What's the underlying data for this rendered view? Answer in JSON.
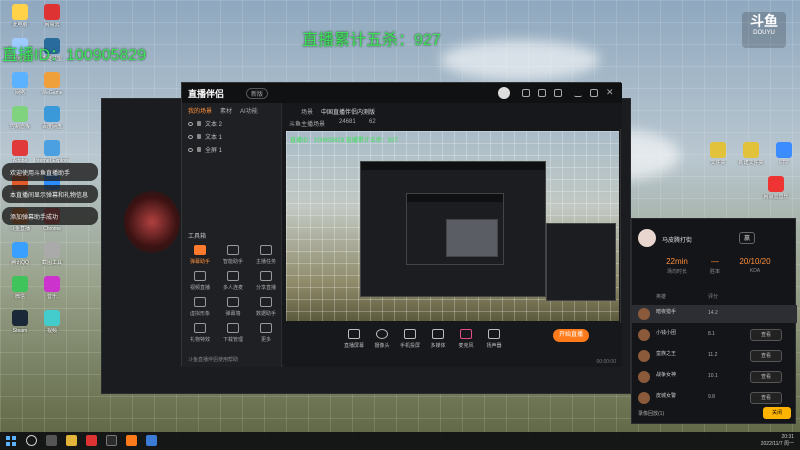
{
  "overlay": {
    "room_id": "直播ID：100905829",
    "penta_kills": "直播累计五杀：927"
  },
  "douyu_logo": {
    "main": "斗鱼",
    "sub": "DOUYU"
  },
  "chat_bubbles": [
    "欢迎使用斗鱼直播助手",
    "本直播间显示弹幕和礼物信息",
    "添加弹幕助手成功"
  ],
  "desktop_icons_left": [
    "此电脑",
    "回收站",
    "网络",
    "控制面板",
    "Adobe",
    "WPS",
    "斗鱼直播",
    "腾讯QQ",
    "微信",
    "Steam",
    "网易云",
    "英雄联盟",
    "WeGame",
    "百度网盘",
    "Internet Explorer",
    "迅雷",
    "Chrome",
    "截图工具",
    "音乐",
    "视频"
  ],
  "desktop_icons_right": [
    "文件夹",
    "新建文件夹",
    "FTP",
    "网易云音乐"
  ],
  "main_window": {
    "brand": "直播伴侣",
    "version": "新版",
    "left_tabs": [
      "我的场景",
      "素材",
      "AI功能"
    ],
    "scenes": [
      "文本 2",
      "文本 1",
      "全屏 1"
    ],
    "toolbox_title": "工具箱",
    "tools": [
      "弹幕助手",
      "智能助手",
      "主播任务",
      "视频直播",
      "多人连麦",
      "分享直播",
      "虚拟形象",
      "弹幕墙",
      "数据助手",
      "礼物特效",
      "下载管理",
      "更多"
    ],
    "footer": "斗鱼直播伴侣使用帮助",
    "stage_labels": [
      "场景",
      "中国直播伴侣内测版",
      "斗鱼主播场景",
      "24681",
      "62"
    ],
    "controls": [
      "直播屏幕",
      "摄像头",
      "手机投屏",
      "多媒体",
      "麦克风",
      "扬声器"
    ],
    "go_live": "开始直播",
    "status": "00:00:00"
  },
  "mini_overlay": "直播ID：100905829   直播累计五杀：927",
  "right_panel": {
    "name": "马皮腾打街",
    "follow": "赢",
    "stats": [
      {
        "value": "22min",
        "key": "场均时长"
      },
      {
        "value": "—",
        "key": "胜率"
      },
      {
        "value": "20/10/20",
        "key": "KDA"
      }
    ],
    "columns": [
      "英雄",
      "评分"
    ],
    "heroes": [
      {
        "name": "暗夜猎手",
        "score": "14.2",
        "btn": ""
      },
      {
        "name": "小钱小团",
        "score": "8.1",
        "btn": "查看"
      },
      {
        "name": "蛮族之王",
        "score": "11.2",
        "btn": "查看"
      },
      {
        "name": "战争女神",
        "score": "10.1",
        "btn": "查看"
      },
      {
        "name": "皮城女警",
        "score": "9.8",
        "btn": "查看"
      }
    ],
    "footer": "录像回放(1)",
    "confirm": "关闭"
  },
  "taskbar": {
    "time": "20:31",
    "date": "2022/11/7 周一"
  },
  "colors": {
    "accent": "#ff7a1a",
    "overlay_green": "#3fe05a"
  }
}
